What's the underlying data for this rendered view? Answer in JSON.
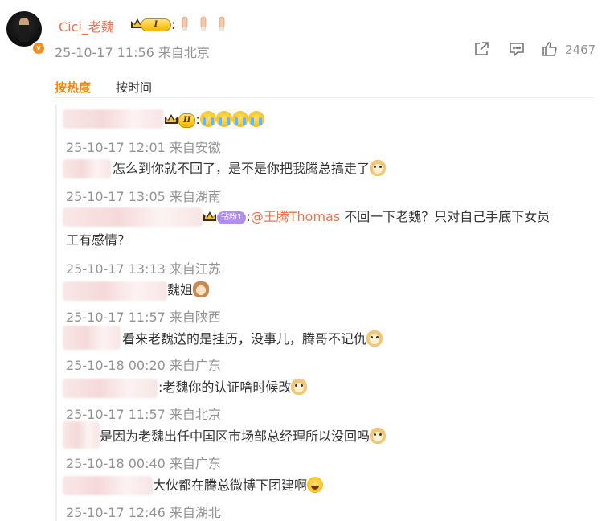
{
  "post": {
    "username": "Cici_老魏",
    "level_badge": "I",
    "colon": ":",
    "time": "25-10-17 11:56 来自北京",
    "like_count": "2467"
  },
  "tabs": {
    "hot": "按热度",
    "time": "按时间"
  },
  "comments": [
    {
      "level": "II",
      "text": ":",
      "time": "25-10-17 12:01 来自安徽"
    },
    {
      "text": "怎么到你就不回了，是不是你把我腾总搞走了",
      "time": "25-10-17 13:05 来自湖南"
    },
    {
      "badge": "钻粉1",
      "prefix": ":",
      "mention": "@王腾Thomas",
      "text_line1": " 不回一下老魏？只对自己手底下女员",
      "text_line2": "工有感情？",
      "time": "25-10-17 13:13 来自江苏"
    },
    {
      "text": "魏姐",
      "time": "25-10-17 11:57 来自陕西"
    },
    {
      "text": "看来老魏送的是挂历，没事儿，腾哥不记仇",
      "time": "25-10-18 00:20 来自广东"
    },
    {
      "text": ":老魏你的认证啥时候改",
      "time": "25-10-17 11:57 来自北京"
    },
    {
      "text": "是因为老魏出任中国区市场部总经理所以没回吗",
      "time": "25-10-18 00:40 来自广东"
    },
    {
      "text": "大伙都在腾总微博下团建啊",
      "time": "25-10-17 12:46 来自湖北"
    }
  ],
  "icons": {
    "share": "share-icon",
    "comment": "comment-icon",
    "like": "thumbs-up-icon"
  },
  "colors": {
    "accent": "#ff8200",
    "username": "#eb7350",
    "meta": "#939393"
  }
}
